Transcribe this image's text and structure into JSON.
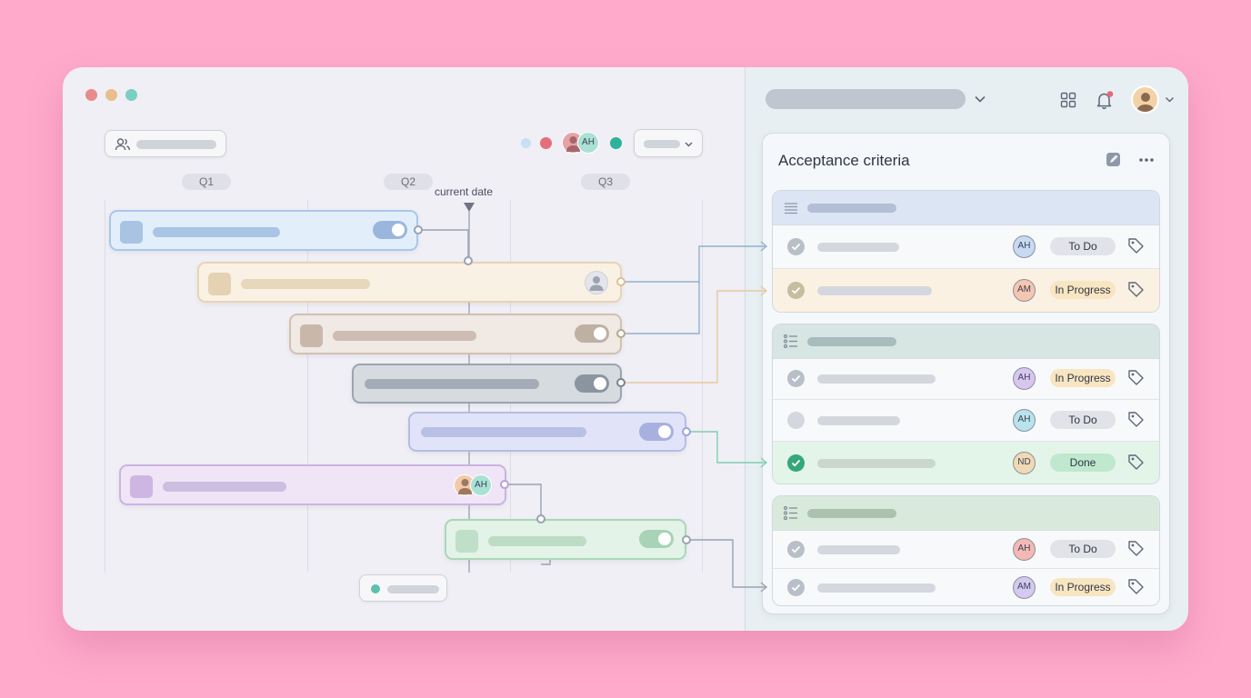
{
  "timeline": {
    "quarters": [
      "Q1",
      "Q2",
      "Q3"
    ],
    "current_date_label": "current date",
    "header_avatars": [
      "AH"
    ],
    "bar_avatar": "AH"
  },
  "panel": {
    "title": "Acceptance criteria",
    "groups": [
      {
        "rows": [
          {
            "assignee": "AH",
            "status": "To Do",
            "checked": true
          },
          {
            "assignee": "AM",
            "status": "In Progress",
            "checked": true
          }
        ]
      },
      {
        "rows": [
          {
            "assignee": "AH",
            "status": "In Progress",
            "checked": true
          },
          {
            "assignee": "AH",
            "status": "To Do",
            "checked": false
          },
          {
            "assignee": "ND",
            "status": "Done",
            "checked": true
          }
        ]
      },
      {
        "rows": [
          {
            "assignee": "AH",
            "status": "To Do",
            "checked": true
          },
          {
            "assignee": "AM",
            "status": "In Progress",
            "checked": true
          }
        ]
      }
    ]
  },
  "icons": [
    "users-icon",
    "chevron-down-icon",
    "grid-icon",
    "bell-icon",
    "user-avatar",
    "edit-icon",
    "more-icon",
    "list-icon",
    "check-icon",
    "tag-icon"
  ],
  "colors": {
    "background": "#ffaacb",
    "todo": "#e1e3e8",
    "in_progress": "#f8e6c2",
    "done": "#bfe8cf"
  }
}
